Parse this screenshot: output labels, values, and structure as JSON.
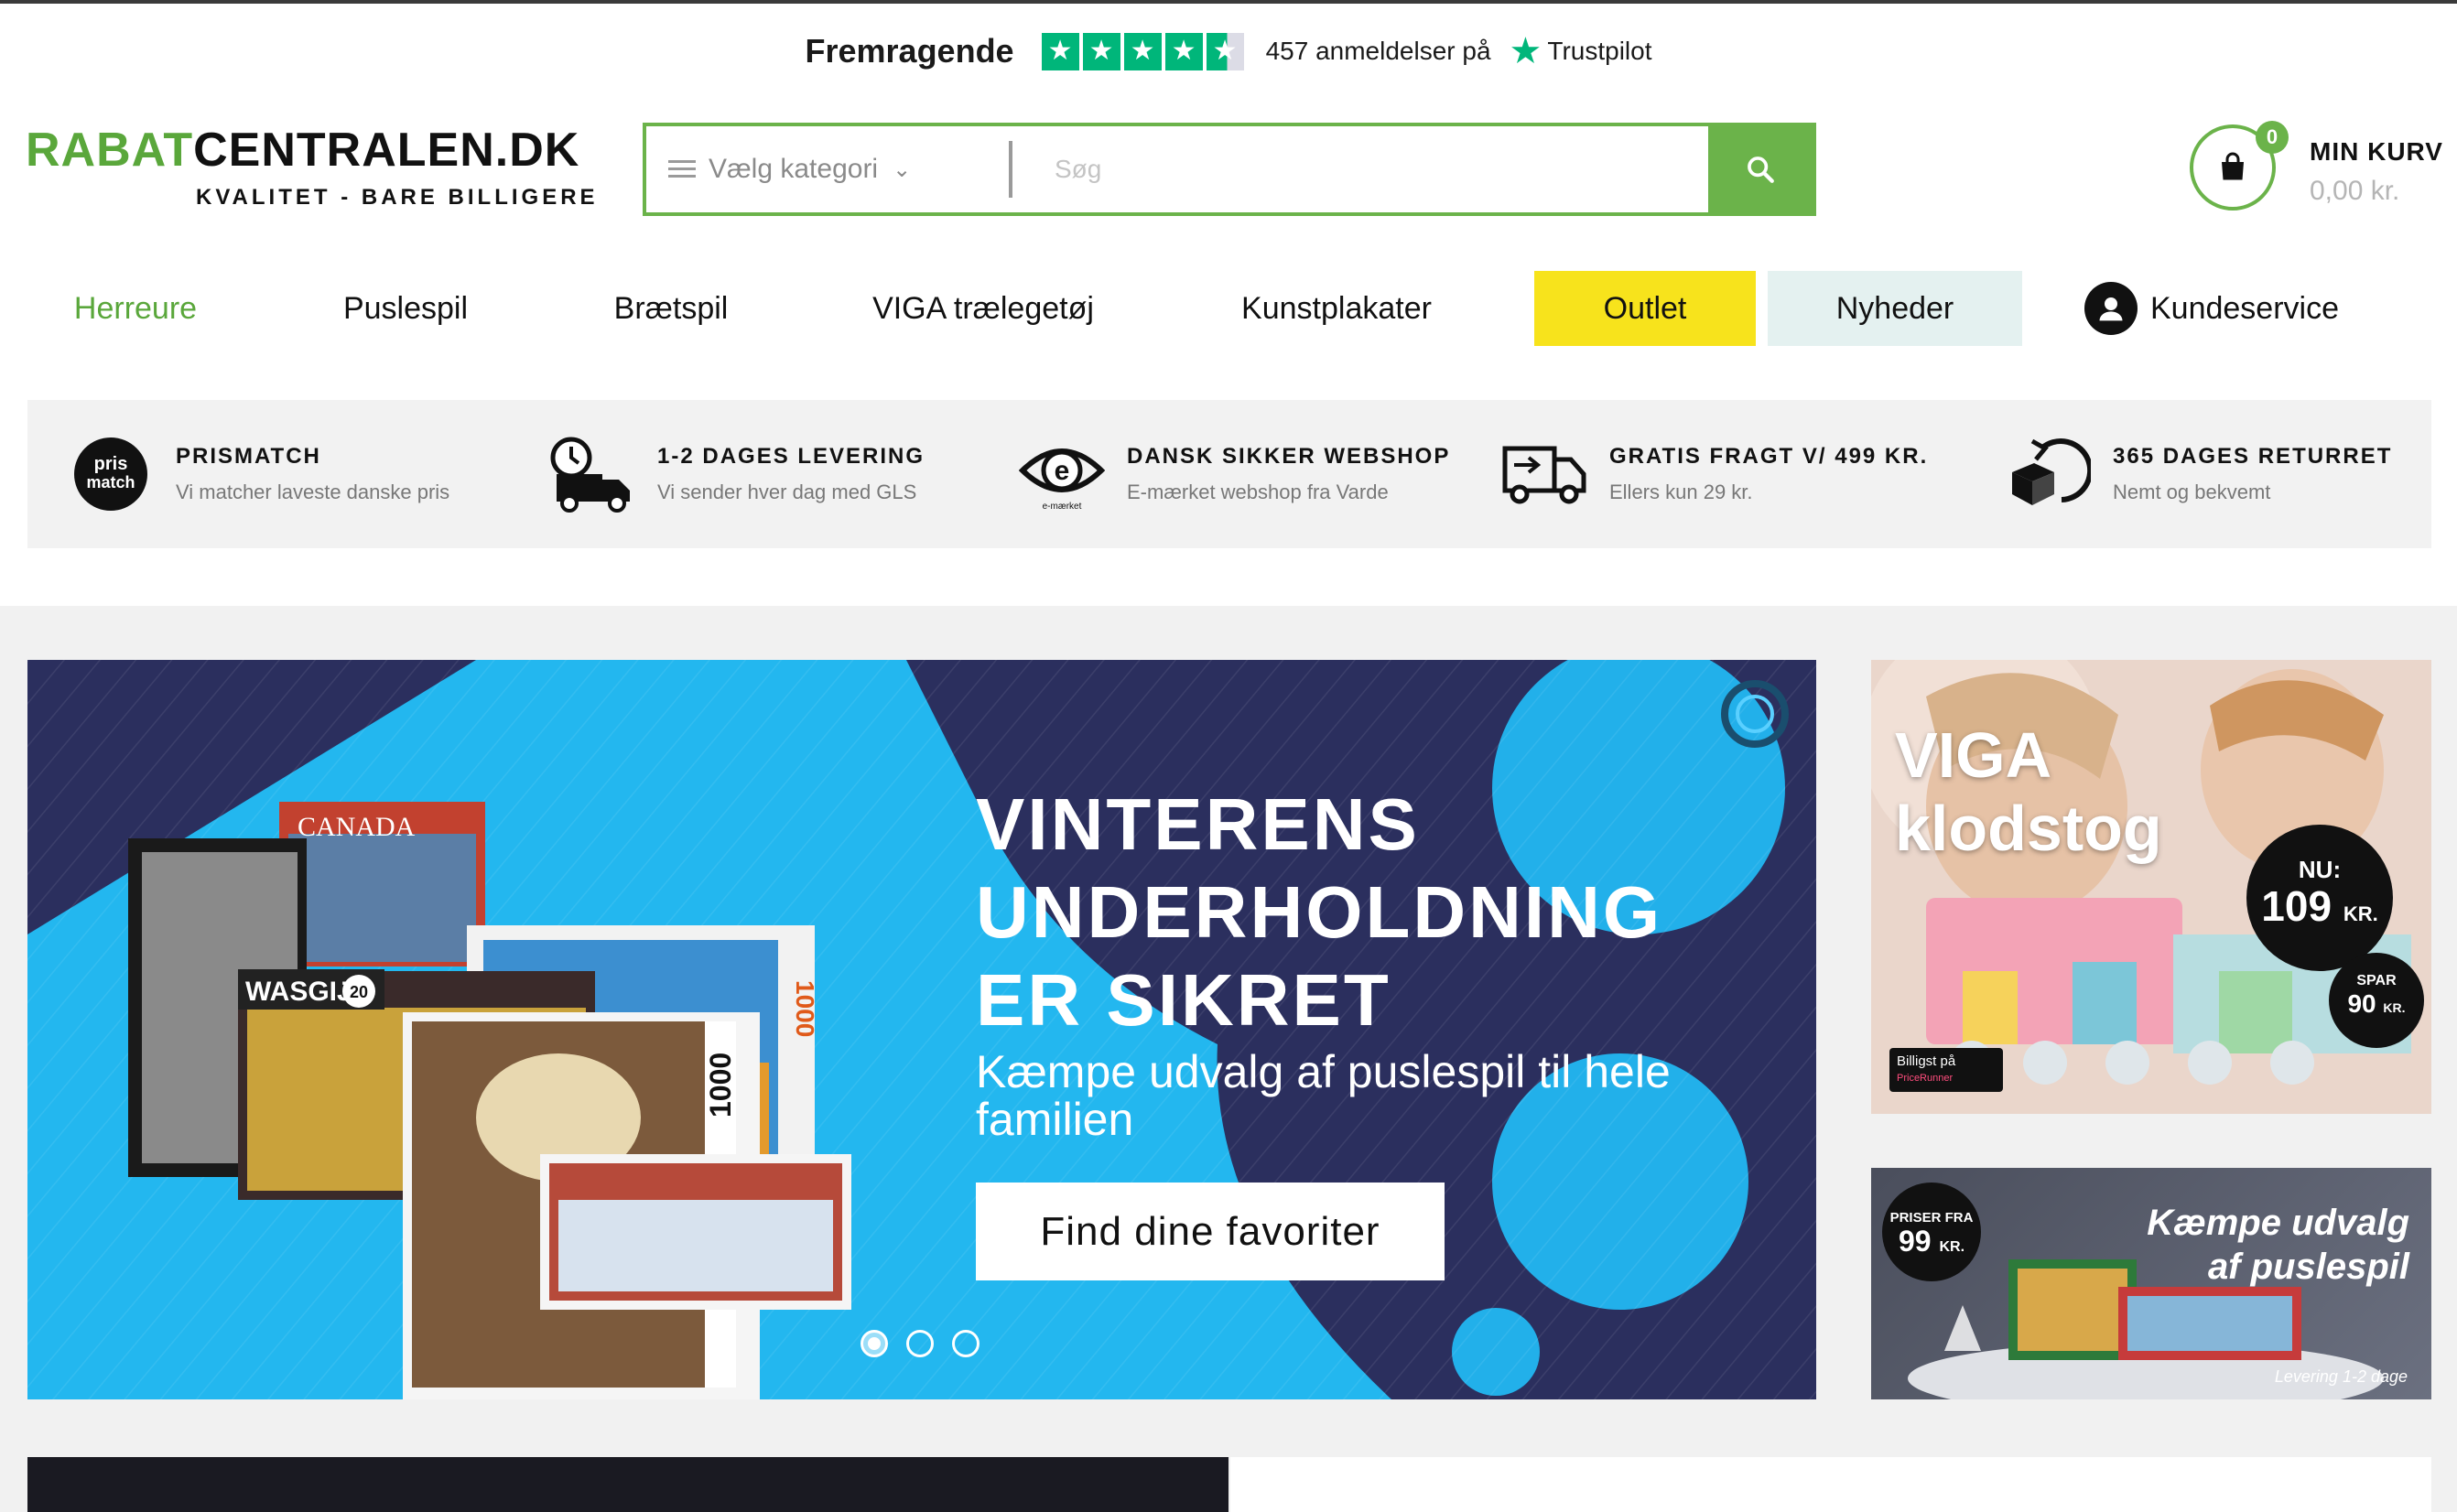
{
  "trustpilot": {
    "rating_label": "Fremragende",
    "stars": 4.5,
    "reviews": "457 anmeldelser på",
    "brand": "Trustpilot",
    "color": "#00b67a"
  },
  "header": {
    "logo_part1": "RABAT",
    "logo_part2": "CENTRALEN.DK",
    "tagline": "KVALITET - BARE BILLIGERE",
    "search": {
      "category_label": "Vælg kategori",
      "placeholder": "Søg",
      "value": ""
    },
    "cart": {
      "title": "MIN KURV",
      "amount": "0,00 kr.",
      "count": "0"
    }
  },
  "nav": {
    "items": [
      {
        "label": "Herreure",
        "active": true
      },
      {
        "label": "Puslespil"
      },
      {
        "label": "Brætspil"
      },
      {
        "label": "VIGA trælegetøj"
      },
      {
        "label": "Kunstplakater"
      },
      {
        "label": "Outlet",
        "highlight": "#f7e31c"
      },
      {
        "label": "Nyheder",
        "highlight": "#e4f1f0"
      },
      {
        "label": "Kundeservice",
        "icon": "user-circle-icon"
      }
    ]
  },
  "usp": [
    {
      "title": "PRISMATCH",
      "subtitle": "Vi matcher laveste danske pris",
      "icon": "prismatch-icon",
      "icon_text_1": "pris",
      "icon_text_2": "match"
    },
    {
      "title": "1-2 DAGES LEVERING",
      "subtitle": "Vi sender hver dag med GLS",
      "icon": "delivery-truck-clock-icon"
    },
    {
      "title": "DANSK SIKKER WEBSHOP",
      "subtitle": "E-mærket webshop fra Varde",
      "icon": "e-maerket-icon",
      "icon_text": "e-mærket"
    },
    {
      "title": "GRATIS FRAGT V/ 499 KR.",
      "subtitle": "Ellers kun 29 kr.",
      "icon": "shipping-truck-icon"
    },
    {
      "title": "365 DAGES RETURRET",
      "subtitle": "Nemt og bekvemt",
      "icon": "return-box-icon"
    }
  ],
  "hero": {
    "headline_1": "VINTERENS",
    "headline_2": "UNDERHOLDNING",
    "headline_3": "ER SIKRET",
    "subline": "Kæmpe udvalg af puslespil til hele familien",
    "cta": "Find dine favoriter",
    "slides": 3,
    "active_slide": 1,
    "puzzle_labels": {
      "canada": "CANADA",
      "wasgij": "WASGIJ",
      "wasgij_number": "20",
      "pieces": "1000"
    }
  },
  "promo_viga": {
    "title_1": "VIGA",
    "title_2": "klodstog",
    "now_label": "NU:",
    "price": "109",
    "price_unit": "KR.",
    "save_label": "SPAR",
    "save": "90",
    "save_unit": "KR.",
    "badge_1": "Billigst på",
    "badge_2": "PriceRunner"
  },
  "promo_puzzles": {
    "from_label": "PRISER FRA",
    "price": "99",
    "price_unit": "KR.",
    "title_1": "Kæmpe udvalg",
    "title_2": "af puslespil",
    "footer": "Levering 1-2 dage"
  },
  "colors": {
    "brand_green": "#5aa73b",
    "search_green": "#6bb34a",
    "outlet_yellow": "#f7e31c",
    "hero_blue": "#23b7ef",
    "hero_navy": "#2a2a5a"
  }
}
